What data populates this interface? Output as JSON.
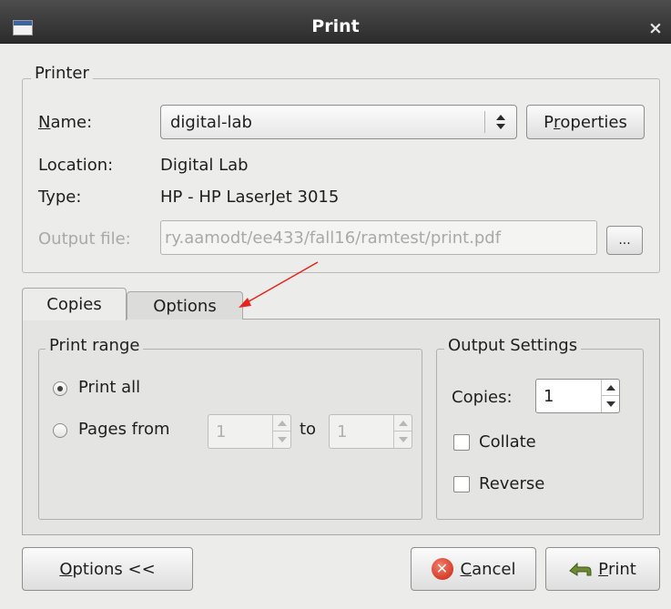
{
  "window": {
    "title": "Print",
    "close_glyph": "×"
  },
  "printer": {
    "frame_label": "Printer",
    "name_label_mnemonic": "N",
    "name_label_rest": "ame:",
    "name_value": "digital-lab",
    "properties_pre": "P",
    "properties_mnemonic": "r",
    "properties_post": "operties",
    "location_label": "Location:",
    "location_value": "Digital Lab",
    "type_label": "Type:",
    "type_value": "HP - HP LaserJet 3015",
    "output_file_label": "Output file:",
    "output_file_value": "ry.aamodt/ee433/fall16/ramtest/print.pdf",
    "browse_label": "..."
  },
  "tabs": {
    "copies": "Copies",
    "options": "Options"
  },
  "print_range": {
    "frame_label": "Print range",
    "print_all": "Print all",
    "pages_from": "Pages from",
    "from_value": "1",
    "to_label": "to",
    "to_value": "1"
  },
  "output_settings": {
    "frame_label": "Output Settings",
    "copies_label": "Copies:",
    "copies_value": "1",
    "collate": "Collate",
    "reverse": "Reverse"
  },
  "buttons": {
    "options_mnemonic": "O",
    "options_rest": "ptions <<",
    "cancel_mnemonic": "C",
    "cancel_rest": "ancel",
    "print_mnemonic": "P",
    "print_rest": "rint"
  },
  "annotation_color": "#e8231a"
}
